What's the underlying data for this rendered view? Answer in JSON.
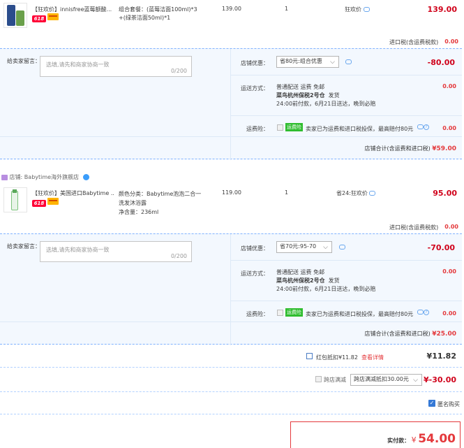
{
  "item1": {
    "title": "【狂欢价】innisfree蓝莓额酸...",
    "sku_line1": "组合套餐：(蓝莓洁面100ml)*3",
    "sku_line2": "+(绿茶洁面50ml)*1",
    "unit_price": "139.00",
    "qty": "1",
    "promo": "狂欢价",
    "subtotal": "139.00"
  },
  "tax1": {
    "label": "进口税(含运费税款)",
    "value": "0.00"
  },
  "order1": {
    "message_label": "给卖家留言：",
    "message_placeholder": "选填,请先和商家协商一致",
    "message_count": "0/200",
    "shop_discount_label": "店铺优惠：",
    "shop_discount_value": "省80元:组合优惠",
    "shop_discount_amount": "-80.00",
    "delivery_label": "运送方式：",
    "delivery_line1": "普通配送 运费 免邮",
    "delivery_line2": "菜鸟杭州保税2号仓",
    "delivery_ship": "发货",
    "delivery_line3": "24:00前付款，6月21日送达，晚到必赔",
    "delivery_amount": "0.00",
    "insurance_label": "运费险：",
    "insurance_badge": "运费险",
    "insurance_text": "卖家已为运费和进口税投保，最高赔付80元",
    "insurance_amount": "0.00",
    "total_label": "店铺合计(含运费和进口税)",
    "total_value": "¥59.00"
  },
  "shop2": {
    "label": "店铺:",
    "name": "Babytime海外旗舰店"
  },
  "item2": {
    "title": "【狂欢价】美国进口Babytime ...",
    "sku_line1": "颜色分类：Babytime泡泡二合一",
    "sku_line2": "洗发沐浴露",
    "sku_line3": "净含量：236ml",
    "unit_price": "119.00",
    "qty": "1",
    "promo": "省24:狂欢价",
    "subtotal": "95.00"
  },
  "tax2": {
    "label": "进口税(含运费税款)",
    "value": "0.00"
  },
  "order2": {
    "message_label": "给卖家留言：",
    "message_placeholder": "选填,请先和商家协商一致",
    "message_count": "0/200",
    "shop_discount_label": "店铺优惠：",
    "shop_discount_value": "省70元:95-70",
    "shop_discount_amount": "-70.00",
    "delivery_label": "运送方式：",
    "delivery_line1": "普通配送 运费 免邮",
    "delivery_line2": "菜鸟杭州保税2号仓",
    "delivery_ship": "发货",
    "delivery_line3": "24:00前付款，6月21日送达，晚到必赔",
    "delivery_amount": "0.00",
    "insurance_label": "运费险：",
    "insurance_badge": "运费险",
    "insurance_text": "卖家已为运费和进口税投保，最高赔付80元",
    "insurance_amount": "0.00",
    "total_label": "店铺合计(含运费和进口税)",
    "total_value": "¥25.00"
  },
  "redpacket": {
    "label": "红包抵扣¥11.82",
    "link": "查看详情",
    "value": "¥11.82"
  },
  "crossshop": {
    "label": "跨店满减",
    "select": "跨店满减抵扣30.00元",
    "value": "¥-30.00"
  },
  "anonymous": {
    "label": "匿名购买"
  },
  "payment": {
    "label": "实付款：",
    "currency": "¥",
    "value": "54.00"
  },
  "colors": {
    "accent": "#d0021b",
    "border_blue": "#b2d1ff",
    "panel_bg": "#f3f8fe"
  }
}
